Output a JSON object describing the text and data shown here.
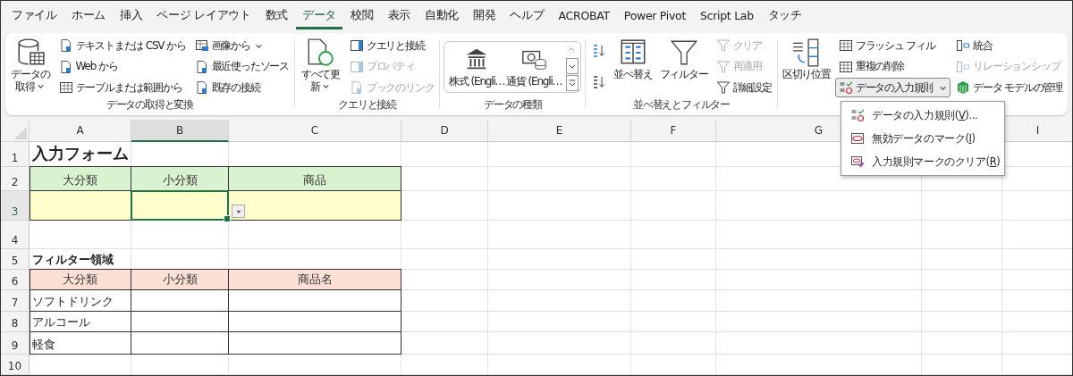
{
  "tabs": [
    {
      "label": "ファイル",
      "selected": false
    },
    {
      "label": "ホーム",
      "selected": false
    },
    {
      "label": "挿入",
      "selected": false
    },
    {
      "label": "ページ レイアウト",
      "selected": false
    },
    {
      "label": "数式",
      "selected": false
    },
    {
      "label": "データ",
      "selected": true
    },
    {
      "label": "校閲",
      "selected": false
    },
    {
      "label": "表示",
      "selected": false
    },
    {
      "label": "自動化",
      "selected": false
    },
    {
      "label": "開発",
      "selected": false
    },
    {
      "label": "ヘルプ",
      "selected": false
    },
    {
      "label": "ACROBAT",
      "selected": false
    },
    {
      "label": "Power Pivot",
      "selected": false
    },
    {
      "label": "Script Lab",
      "selected": false
    },
    {
      "label": "タッチ",
      "selected": false
    }
  ],
  "ribbon_groups": [
    {
      "kind": "buttons",
      "label": "データの取得と変換",
      "columns": [
        [
          {
            "kind": "large",
            "label": "データの取得",
            "dropdown": true,
            "disabled": false
          }
        ],
        [
          {
            "kind": "small",
            "label": "テキストまたは CSV から",
            "disabled": false
          },
          {
            "kind": "small",
            "label": "Web から",
            "disabled": false
          },
          {
            "kind": "small",
            "label": "テーブルまたは範囲から",
            "disabled": false
          }
        ],
        [
          {
            "kind": "small",
            "label": "画像から",
            "dropdown": true,
            "disabled": false
          },
          {
            "kind": "small",
            "label": "最近使ったソース",
            "disabled": false
          },
          {
            "kind": "small",
            "label": "既存の接続",
            "disabled": false
          }
        ]
      ]
    },
    {
      "kind": "buttons",
      "label": "クエリと接続",
      "columns": [
        [
          {
            "kind": "large",
            "label": "すべて更新",
            "dropdown": true,
            "disabled": false
          }
        ],
        [
          {
            "kind": "small",
            "label": "クエリと接続",
            "disabled": false
          },
          {
            "kind": "small",
            "label": "プロパティ",
            "disabled": true
          },
          {
            "kind": "small",
            "label": "ブックのリンク",
            "disabled": true
          }
        ]
      ]
    },
    {
      "kind": "gallery",
      "label": "データの種類",
      "columns": [
        [
          {
            "kind": "gallery",
            "label": "株式 (Engli…"
          },
          {
            "kind": "gallery",
            "label": "通貨 (Engli…"
          }
        ]
      ]
    },
    {
      "kind": "buttons",
      "label": "並べ替えとフィルター",
      "columns": [
        [
          {
            "kind": "icon"
          },
          {
            "kind": "icon"
          }
        ],
        [
          {
            "kind": "large",
            "label": "並べ替え",
            "disabled": false
          }
        ],
        [
          {
            "kind": "large",
            "label": "フィルター",
            "disabled": false
          }
        ],
        [
          {
            "kind": "small",
            "label": "クリア",
            "disabled": true
          },
          {
            "kind": "small",
            "label": "再適用",
            "disabled": true
          },
          {
            "kind": "small",
            "label": "詳細設定",
            "disabled": false
          }
        ]
      ]
    },
    {
      "kind": "buttons",
      "columns": [
        [
          {
            "kind": "large",
            "label": "区切り位置",
            "disabled": false
          }
        ],
        [
          {
            "kind": "small",
            "label": "フラッシュ フィル",
            "disabled": false
          },
          {
            "kind": "small",
            "label": "重複の削除",
            "disabled": false
          },
          {
            "kind": "small",
            "label": "データの入力規則",
            "dropdown": true,
            "expanded": true,
            "disabled": false
          }
        ],
        [
          {
            "kind": "small",
            "label": "統合",
            "disabled": false
          },
          {
            "kind": "small",
            "label": "リレーションシップ",
            "disabled": true
          },
          {
            "kind": "small",
            "label": "データ モデルの管理",
            "disabled": false
          }
        ]
      ]
    }
  ],
  "column_headers": [
    {
      "label": "A",
      "selected": false
    },
    {
      "label": "B",
      "selected": true
    },
    {
      "label": "C",
      "selected": false
    },
    {
      "label": "D",
      "selected": false
    },
    {
      "label": "E",
      "selected": false
    },
    {
      "label": "F",
      "selected": false
    },
    {
      "label": "G",
      "selected": false
    },
    {
      "label": "I",
      "selected": false
    }
  ],
  "rows": [
    {
      "number": "1",
      "selected": false,
      "cells": [
        {
          "kind": "title",
          "text": "入力フォーム"
        }
      ]
    },
    {
      "number": "2",
      "selected": false,
      "cells": [
        {
          "kind": "form-header",
          "text": "大分類"
        },
        {
          "kind": "form-header",
          "text": "小分類"
        },
        {
          "kind": "form-header",
          "text": "商品"
        }
      ]
    },
    {
      "number": "3",
      "selected": true,
      "cells": [
        {
          "kind": "input",
          "selected": false
        },
        {
          "kind": "input",
          "selected": true,
          "dropdown": true
        },
        {
          "kind": "input",
          "selected": false
        }
      ]
    },
    {
      "number": "4",
      "selected": false
    },
    {
      "number": "5",
      "selected": false,
      "cells": [
        {
          "kind": "section-title",
          "text": "フィルター領域"
        }
      ]
    },
    {
      "number": "6",
      "selected": false,
      "cells": [
        {
          "kind": "filter-header",
          "text": "大分類"
        },
        {
          "kind": "filter-header",
          "text": "小分類"
        },
        {
          "kind": "filter-header",
          "text": "商品名"
        }
      ]
    },
    {
      "number": "7",
      "selected": false,
      "cells": [
        {
          "kind": "data",
          "text": "ソフトドリンク"
        },
        {
          "kind": "data"
        },
        {
          "kind": "data"
        }
      ]
    },
    {
      "number": "8",
      "selected": false,
      "cells": [
        {
          "kind": "data",
          "text": "アルコール"
        },
        {
          "kind": "data"
        },
        {
          "kind": "data"
        }
      ]
    },
    {
      "number": "9",
      "selected": false,
      "cells": [
        {
          "kind": "data",
          "text": "軽食"
        },
        {
          "kind": "data"
        },
        {
          "kind": "data"
        }
      ]
    },
    {
      "number": "10",
      "selected": false
    }
  ],
  "dropdown_menu": [
    {
      "before": "データの入力規則(",
      "mnemonic": "V",
      "after": ")..."
    },
    {
      "before": "無効データのマーク(",
      "mnemonic": "I",
      "after": ")"
    },
    {
      "before": "入力規則マークのクリア(",
      "mnemonic": "R",
      "after": ")"
    }
  ]
}
